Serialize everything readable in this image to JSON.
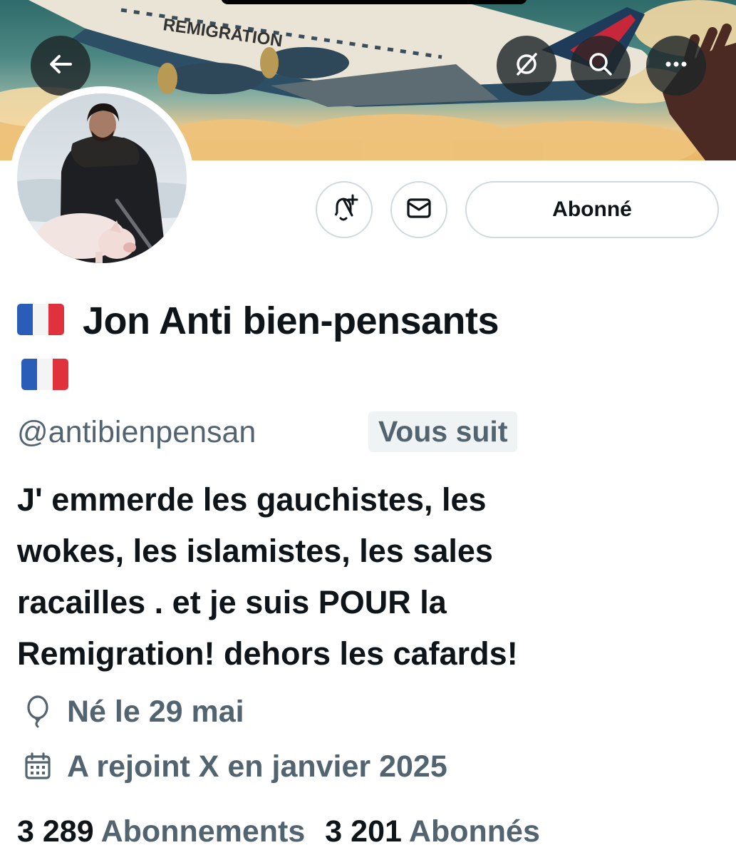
{
  "banner": {
    "plane_text": "REMIGRATION"
  },
  "nav": {
    "back_icon": "arrow-left-icon",
    "grok_icon": "slashed-circle-icon",
    "search_icon": "search-icon",
    "more_icon": "more-horizontal-icon"
  },
  "actions": {
    "notify_icon": "bell-plus-icon",
    "message_icon": "envelope-icon",
    "follow_label": "Abonné"
  },
  "profile": {
    "name": "Jon Anti bien-pensants",
    "name_emoji": "french-flag",
    "handle": "@antibienpensan",
    "follows_you": "Vous suit",
    "bio_lines": [
      "J' emmerde les gauchistes, les",
      "wokes, les islamistes, les sales",
      "racailles . et je suis POUR la",
      "Remigration! dehors les cafards!"
    ],
    "birthday": "Né le 29 mai",
    "joined": "A rejoint X en janvier 2025"
  },
  "stats": {
    "following_count": "3 289",
    "following_label": "Abonnements",
    "followers_count": "3 201",
    "followers_label": "Abonnés"
  },
  "colors": {
    "text_primary": "#0f1419",
    "text_secondary": "#536471",
    "border": "#cfd9de",
    "badge_bg": "#eff3f4"
  }
}
